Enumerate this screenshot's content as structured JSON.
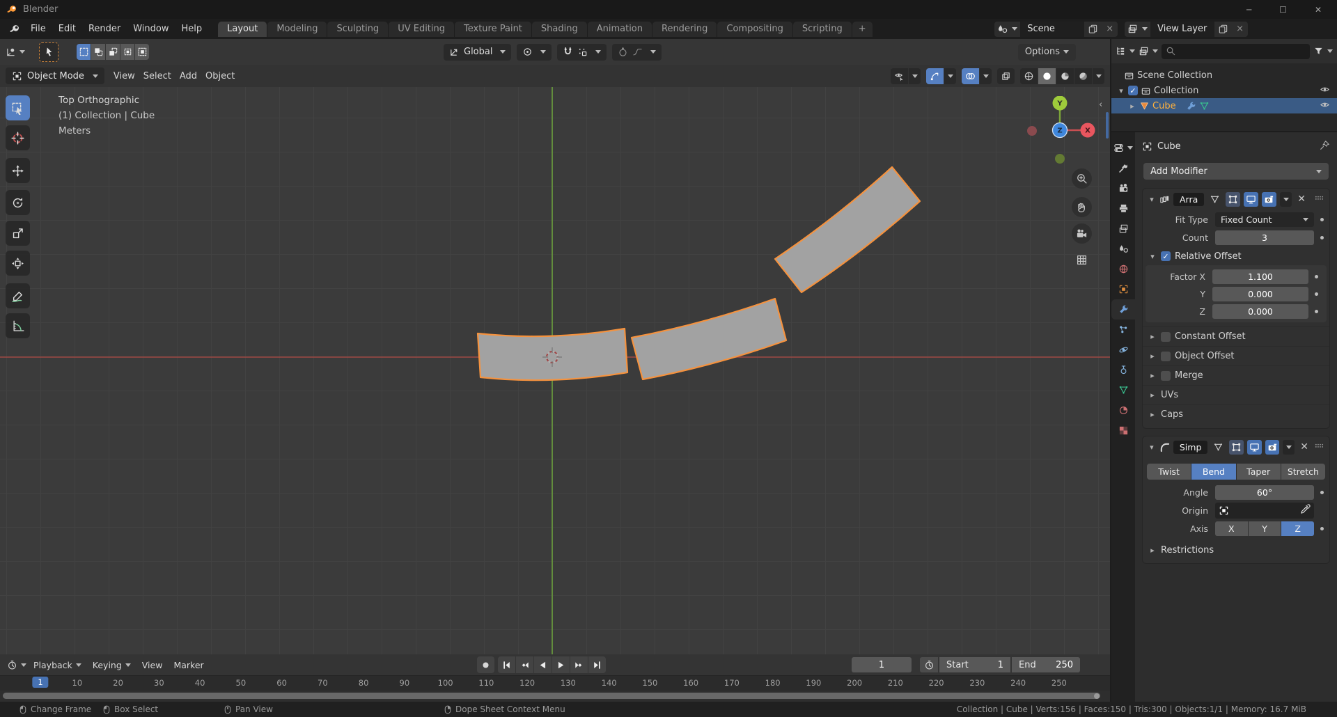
{
  "window": {
    "title": "Blender"
  },
  "topbar": {
    "menus": [
      "File",
      "Edit",
      "Render",
      "Window",
      "Help"
    ],
    "tabs": [
      "Layout",
      "Modeling",
      "Sculpting",
      "UV Editing",
      "Texture Paint",
      "Shading",
      "Animation",
      "Rendering",
      "Compositing",
      "Scripting"
    ],
    "active_tab": "Layout",
    "new_tab_label": "+",
    "scene_name": "Scene",
    "view_layer_name": "View Layer"
  },
  "tool_settings": {
    "select_modes": [
      "select-new",
      "select-extend",
      "select-subtract",
      "select-invert",
      "select-intersect"
    ],
    "active_select_mode": "select-new",
    "orientation_label": "Global",
    "options_label": "Options"
  },
  "viewport": {
    "mode_label": "Object Mode",
    "menus": [
      "View",
      "Select",
      "Add",
      "Object"
    ],
    "tools": [
      "select-box",
      "cursor",
      "move",
      "rotate",
      "scale",
      "transform",
      "annotate",
      "measure"
    ],
    "active_tool": "select-box",
    "shading_modes": [
      "wireframe",
      "solid",
      "material-preview",
      "rendered"
    ],
    "active_shading": "solid",
    "overlay": {
      "line1": "Top Orthographic",
      "line2": "(1) Collection | Cube",
      "line3": "Meters"
    },
    "gizmo": {
      "x": "X",
      "y": "Y",
      "z": "Z"
    }
  },
  "outliner": {
    "items": [
      {
        "label": "Scene Collection"
      },
      {
        "label": "Collection"
      },
      {
        "label": "Cube"
      }
    ]
  },
  "properties": {
    "breadcrumb": "Cube",
    "add_modifier_label": "Add Modifier",
    "nav_tabs": [
      "tool",
      "render",
      "output",
      "view-layer",
      "scene",
      "world",
      "object",
      "modifiers",
      "particles",
      "physics",
      "constraints",
      "object-data",
      "material",
      "texture"
    ],
    "active_nav": "modifiers",
    "array_modifier": {
      "name": "Arra",
      "fit_type_label": "Fit Type",
      "fit_type_value": "Fixed Count",
      "count_label": "Count",
      "count_value": "3",
      "relative_offset_label": "Relative Offset",
      "factor_rows": [
        {
          "label": "Factor X",
          "value": "1.100"
        },
        {
          "label": "Y",
          "value": "0.000"
        },
        {
          "label": "Z",
          "value": "0.000"
        }
      ],
      "checkbox_sections": [
        "Constant Offset",
        "Object Offset",
        "Merge"
      ],
      "plain_sections": [
        "UVs",
        "Caps"
      ]
    },
    "simple_deform_modifier": {
      "name": "Simp",
      "modes": [
        "Twist",
        "Bend",
        "Taper",
        "Stretch"
      ],
      "active_mode": "Bend",
      "angle_label": "Angle",
      "angle_value": "60°",
      "origin_label": "Origin",
      "axis_label": "Axis",
      "axis_options": [
        "X",
        "Y",
        "Z"
      ],
      "active_axis": "Z",
      "restrictions_label": "Restrictions"
    }
  },
  "timeline": {
    "menus": [
      {
        "label": "Playback",
        "dropdown": true
      },
      {
        "label": "Keying",
        "dropdown": true
      },
      {
        "label": "View",
        "dropdown": false
      },
      {
        "label": "Marker",
        "dropdown": false
      }
    ],
    "current_frame": "1",
    "start_label": "Start",
    "start_value": "1",
    "end_label": "End",
    "end_value": "250",
    "ruler_frames": [
      1,
      10,
      20,
      30,
      40,
      50,
      60,
      70,
      80,
      90,
      100,
      110,
      120,
      130,
      140,
      150,
      160,
      170,
      180,
      190,
      200,
      210,
      220,
      230,
      240,
      250
    ],
    "transport": [
      "jump-to-start",
      "previous-keyframe",
      "play-reverse",
      "play",
      "next-keyframe",
      "jump-to-end"
    ]
  },
  "status_bar": {
    "hints": [
      {
        "icon": "mouse-left",
        "label": "Change Frame"
      },
      {
        "icon": "mouse-left",
        "label": "Box Select"
      },
      {
        "icon": "mouse-middle",
        "label": "Pan View"
      },
      {
        "icon": "mouse-right",
        "label": "Dope Sheet Context Menu"
      }
    ],
    "stats": "Collection | Cube | Verts:156 | Faces:150 | Tris:300 | Objects:1/1 | Memory: 16.7 MiB"
  },
  "colors": {
    "accent": "#4772b3",
    "accent_hi": "#5680c2",
    "object_orange": "#f5923e",
    "object_fill": "#a2a2a2",
    "axis_green": "#67993c",
    "axis_red": "#9a4844",
    "text_orange": "#ffb13d"
  }
}
